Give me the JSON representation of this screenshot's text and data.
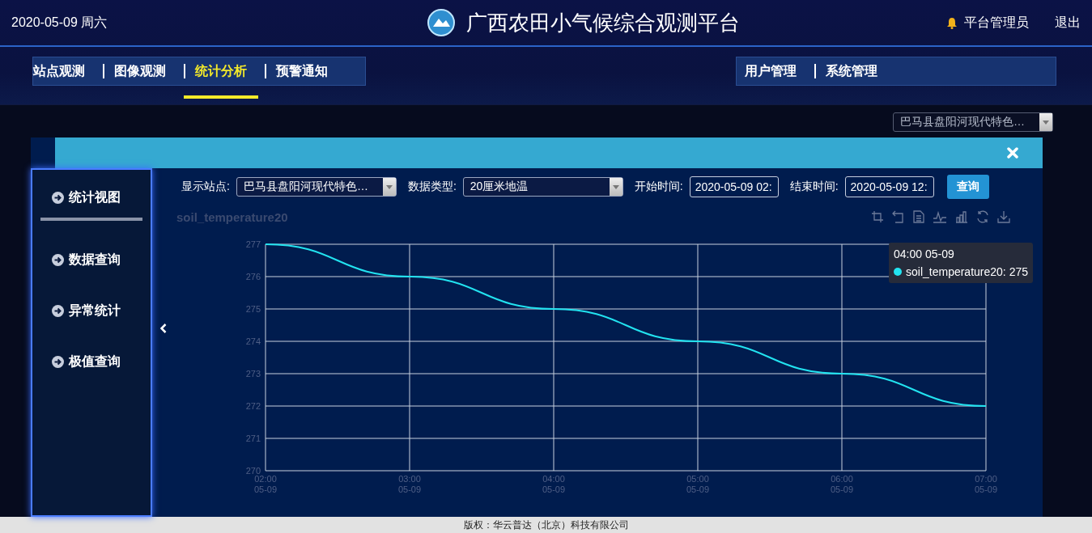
{
  "header": {
    "date": "2020-05-09 周六",
    "title": "广西农田小气候综合观测平台",
    "user": "平台管理员",
    "logout": "退出"
  },
  "nav_left": [
    {
      "label": "站点观测",
      "selected": false
    },
    {
      "label": "图像观测",
      "selected": false
    },
    {
      "label": "统计分析",
      "selected": true
    },
    {
      "label": "预警通知",
      "selected": false
    }
  ],
  "nav_right": [
    {
      "label": "用户管理",
      "selected": false
    },
    {
      "label": "系统管理",
      "selected": false
    }
  ],
  "station_select": {
    "value": "巴马县盘阳河现代特色…"
  },
  "dialog": {
    "side_menu": [
      {
        "label": "统计视图",
        "selected": true
      },
      {
        "label": "数据查询",
        "selected": false
      },
      {
        "label": "异常统计",
        "selected": false
      },
      {
        "label": "极值查询",
        "selected": false
      }
    ],
    "filters": {
      "station_label": "显示站点:",
      "station_value": "巴马县盘阳河现代特色…",
      "type_label": "数据类型:",
      "type_value": "20厘米地温",
      "start_label": "开始时间:",
      "start_value": "2020-05-09 02:",
      "end_label": "结束时间:",
      "end_value": "2020-05-09 12:",
      "query_button": "查询"
    },
    "chart": {
      "chart_data": {
        "type": "line",
        "title": "soil_temperature20",
        "categories": [
          "02:00 05-09",
          "03:00 05-09",
          "04:00 05-09",
          "05:00 05-09",
          "06:00 05-09",
          "07:00 05-09"
        ],
        "series": [
          {
            "name": "soil_temperature20",
            "color": "#22e3f0",
            "values": [
              277,
              276,
              275,
              274,
              273,
              272
            ]
          }
        ],
        "ylim": [
          270,
          277
        ],
        "grid": true,
        "yticks": [
          270,
          271,
          272,
          273,
          274,
          275,
          276,
          277
        ]
      },
      "tooltip": {
        "title": "04:00 05-09",
        "value": ": 275"
      }
    }
  },
  "footer": "版权：华云普达（北京）科技有限公司"
}
